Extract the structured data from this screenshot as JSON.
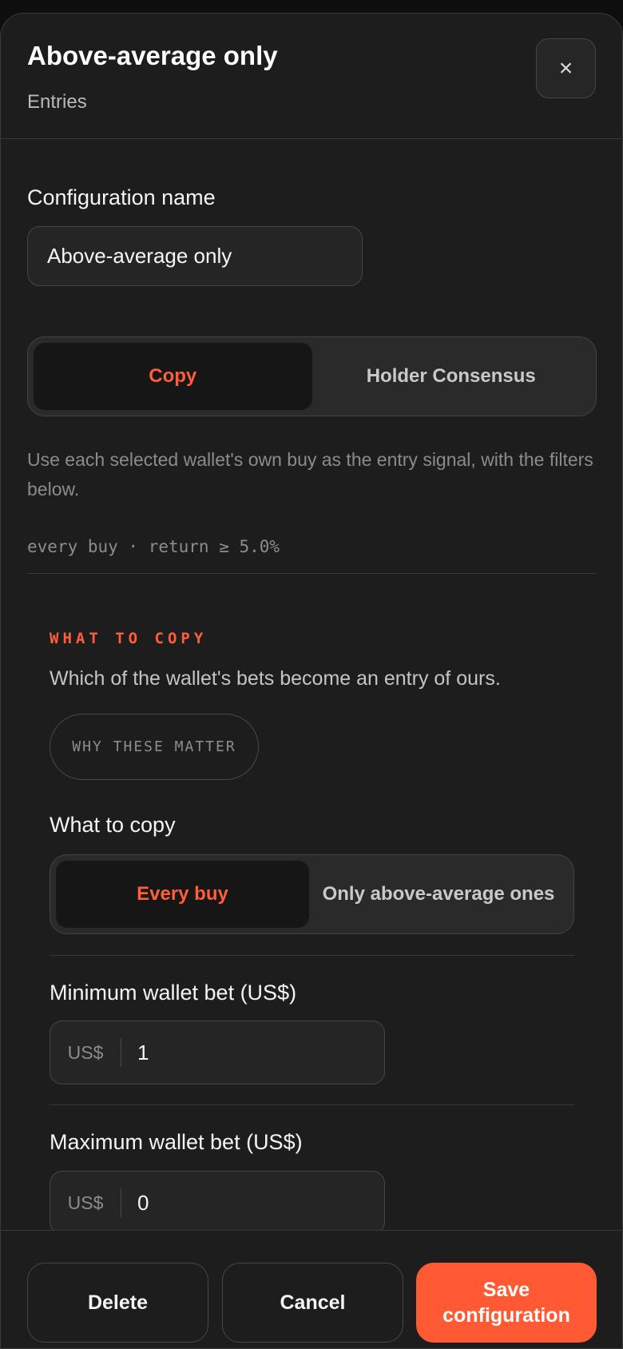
{
  "header": {
    "title": "Above-average only",
    "subtitle": "Entries",
    "close_label": "×"
  },
  "config": {
    "name_label": "Configuration name",
    "name_value": "Above-average only"
  },
  "mode": {
    "options": [
      "Copy",
      "Holder Consensus"
    ],
    "selected": "Copy",
    "description": "Use each selected wallet's own buy as the entry signal, with the filters below.",
    "summary": "every buy · return ≥ 5.0%"
  },
  "what_to_copy": {
    "section_title": "WHAT TO COPY",
    "section_description": "Which of the wallet's bets become an entry of ours.",
    "why_button": "WHY THESE MATTER",
    "field_label": "What to copy",
    "options": [
      "Every buy",
      "Only above-average ones"
    ],
    "selected": "Every buy"
  },
  "min_bet": {
    "label": "Minimum wallet bet (US$)",
    "prefix": "US$",
    "value": "1"
  },
  "max_bet": {
    "label": "Maximum wallet bet (US$)",
    "prefix": "US$",
    "value": "0"
  },
  "footer": {
    "delete_label": "Delete",
    "cancel_label": "Cancel",
    "save_label": "Save configuration"
  },
  "colors": {
    "accent": "#ff5a33",
    "background": "#1d1d1d"
  }
}
